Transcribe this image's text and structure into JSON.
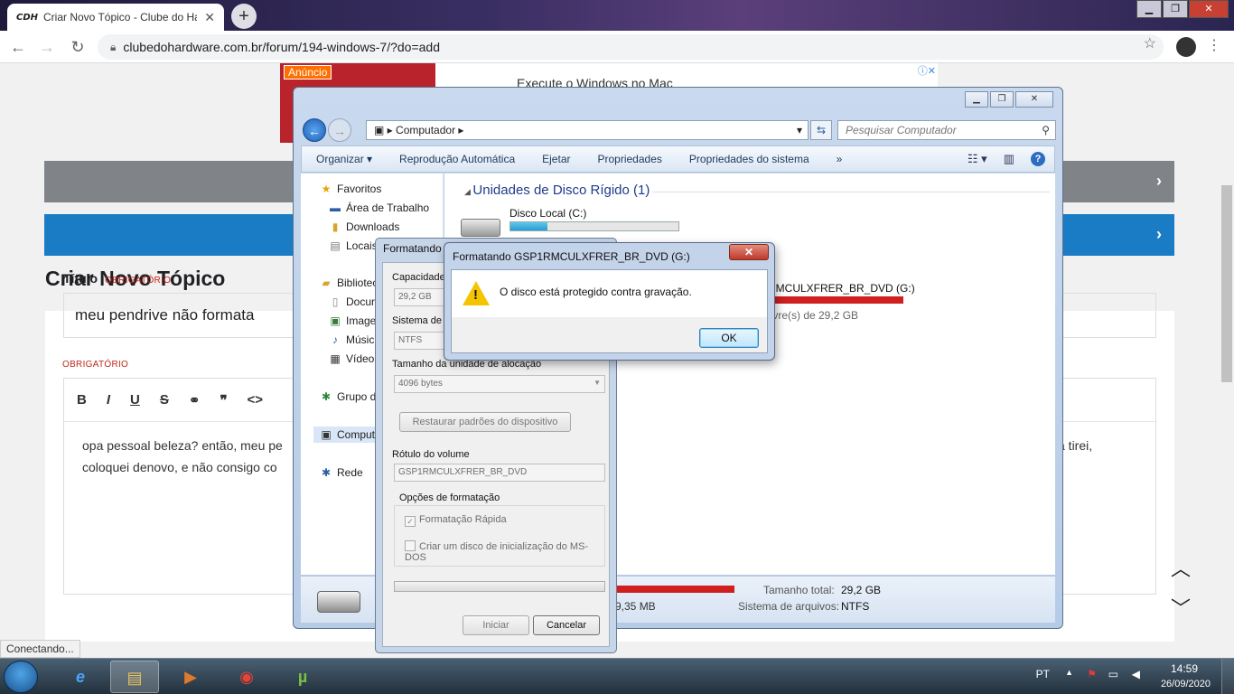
{
  "browser": {
    "tab_title": "Criar Novo Tópico - Clube do Ha",
    "tab_favicon": "CDH",
    "url": "clubedohardware.com.br/forum/194-windows-7/?do=add",
    "status": "Conectando..."
  },
  "page": {
    "ad_badge": "Anúncio",
    "ad_text": "Execute o Windows no Mac",
    "title": "Criar Novo Tópico",
    "title_label": "Título",
    "required": "OBRIGATÓRIO",
    "title_value": "meu pendrive não formata",
    "editor_text_start": "opa pessoal beleza? então, meu pe",
    "editor_text_line2": "coloquei denovo, e não consigo co",
    "editor_text_end": "a tirei,"
  },
  "explorer": {
    "address": "Computador",
    "search_placeholder": "Pesquisar Computador",
    "commands": [
      "Organizar ▾",
      "Reprodução Automática",
      "Ejetar",
      "Propriedades",
      "Propriedades do sistema",
      "»"
    ],
    "nav": {
      "favorites": "Favoritos",
      "desktop": "Área de Trabalho",
      "downloads": "Downloads",
      "recent": "Locais",
      "libraries": "Bibliotec",
      "documents": "Docur",
      "images": "Image",
      "music": "Músic",
      "videos": "Vídeos",
      "homegroup": "Grupo d",
      "computer": "Comput",
      "network": "Rede"
    },
    "group_header": "Unidades de Disco Rígido (1)",
    "drive_c_label": "Disco Local (C:)",
    "drive_c_used": 0.22,
    "drive_g_label": "RMCULXFRER_BR_DVD (G:)",
    "drive_g_free": "livre(s) de 29,2 GB",
    "details": {
      "free_partial": "9,35 MB",
      "total_label": "Tamanho total:",
      "total_value": "29,2 GB",
      "fs_label": "Sistema de arquivos:",
      "fs_value": "NTFS"
    }
  },
  "format_dialog": {
    "title": "Formatando",
    "capacity_label": "Capacidade",
    "capacity_value": "29,2 GB",
    "fs_label": "Sistema de a",
    "fs_value": "NTFS",
    "alloc_label": "Tamanho da unidade de alocação",
    "alloc_value": "4096 bytes",
    "restore_button": "Restaurar padrões do dispositivo",
    "volume_label": "Rótulo do volume",
    "volume_value": "GSP1RMCULXFRER_BR_DVD",
    "options_label": "Opções de formatação",
    "quick_format": "Formatação Rápida",
    "msdos_disk": "Criar um disco de inicialização do MS-DOS",
    "start_button": "Iniciar",
    "cancel_button": "Cancelar"
  },
  "message_box": {
    "title": "Formatando GSP1RMCULXFRER_BR_DVD (G:)",
    "text": "O disco está protegido contra gravação.",
    "ok": "OK"
  },
  "taskbar": {
    "language": "PT",
    "time": "14:59",
    "date": "26/09/2020"
  }
}
